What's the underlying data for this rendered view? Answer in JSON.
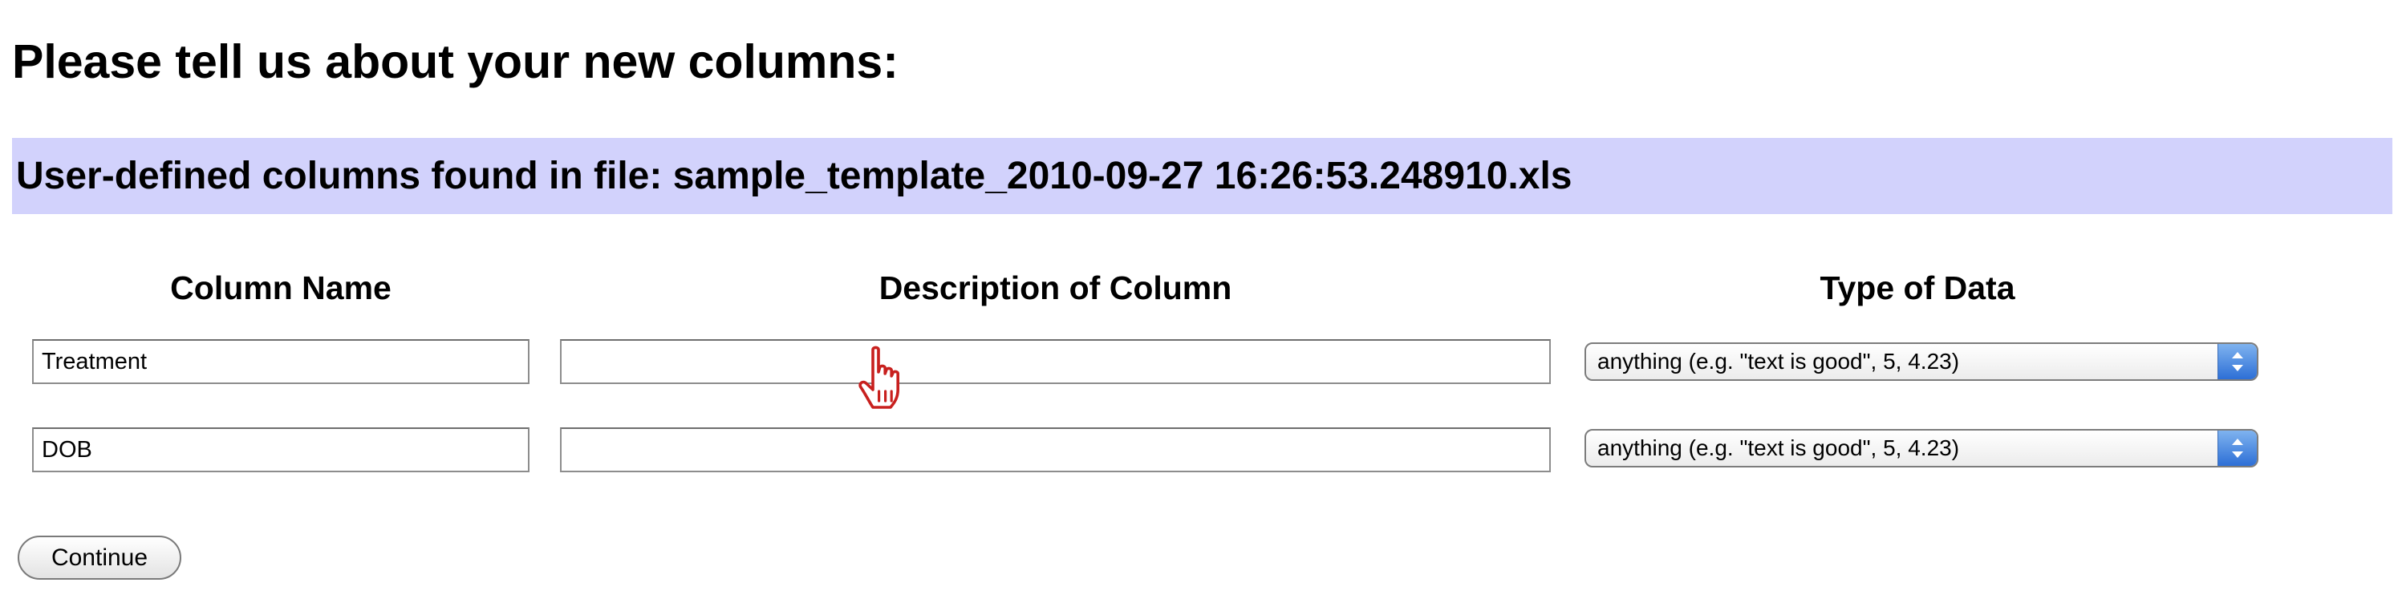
{
  "page": {
    "title": "Please tell us about your new columns:"
  },
  "file_banner": {
    "text": "User-defined columns found in file: sample_template_2010-09-27 16:26:53.248910.xls"
  },
  "table": {
    "headers": {
      "column_name": "Column Name",
      "description": "Description of Column",
      "type": "Type of Data"
    },
    "rows": [
      {
        "column_name": "Treatment",
        "description": "",
        "type": "anything (e.g. \"text is good\", 5, 4.23)"
      },
      {
        "column_name": "DOB",
        "description": "",
        "type": "anything (e.g. \"text is good\", 5, 4.23)"
      }
    ]
  },
  "actions": {
    "continue_label": "Continue"
  },
  "icons": {
    "select_stepper": "up-down-arrows-icon",
    "pointer": "hand-pointer-cursor-icon"
  },
  "colors": {
    "banner_background": "#d2d2fc",
    "stepper_accent": "#3f7fe0",
    "cursor": "#c8201e"
  }
}
